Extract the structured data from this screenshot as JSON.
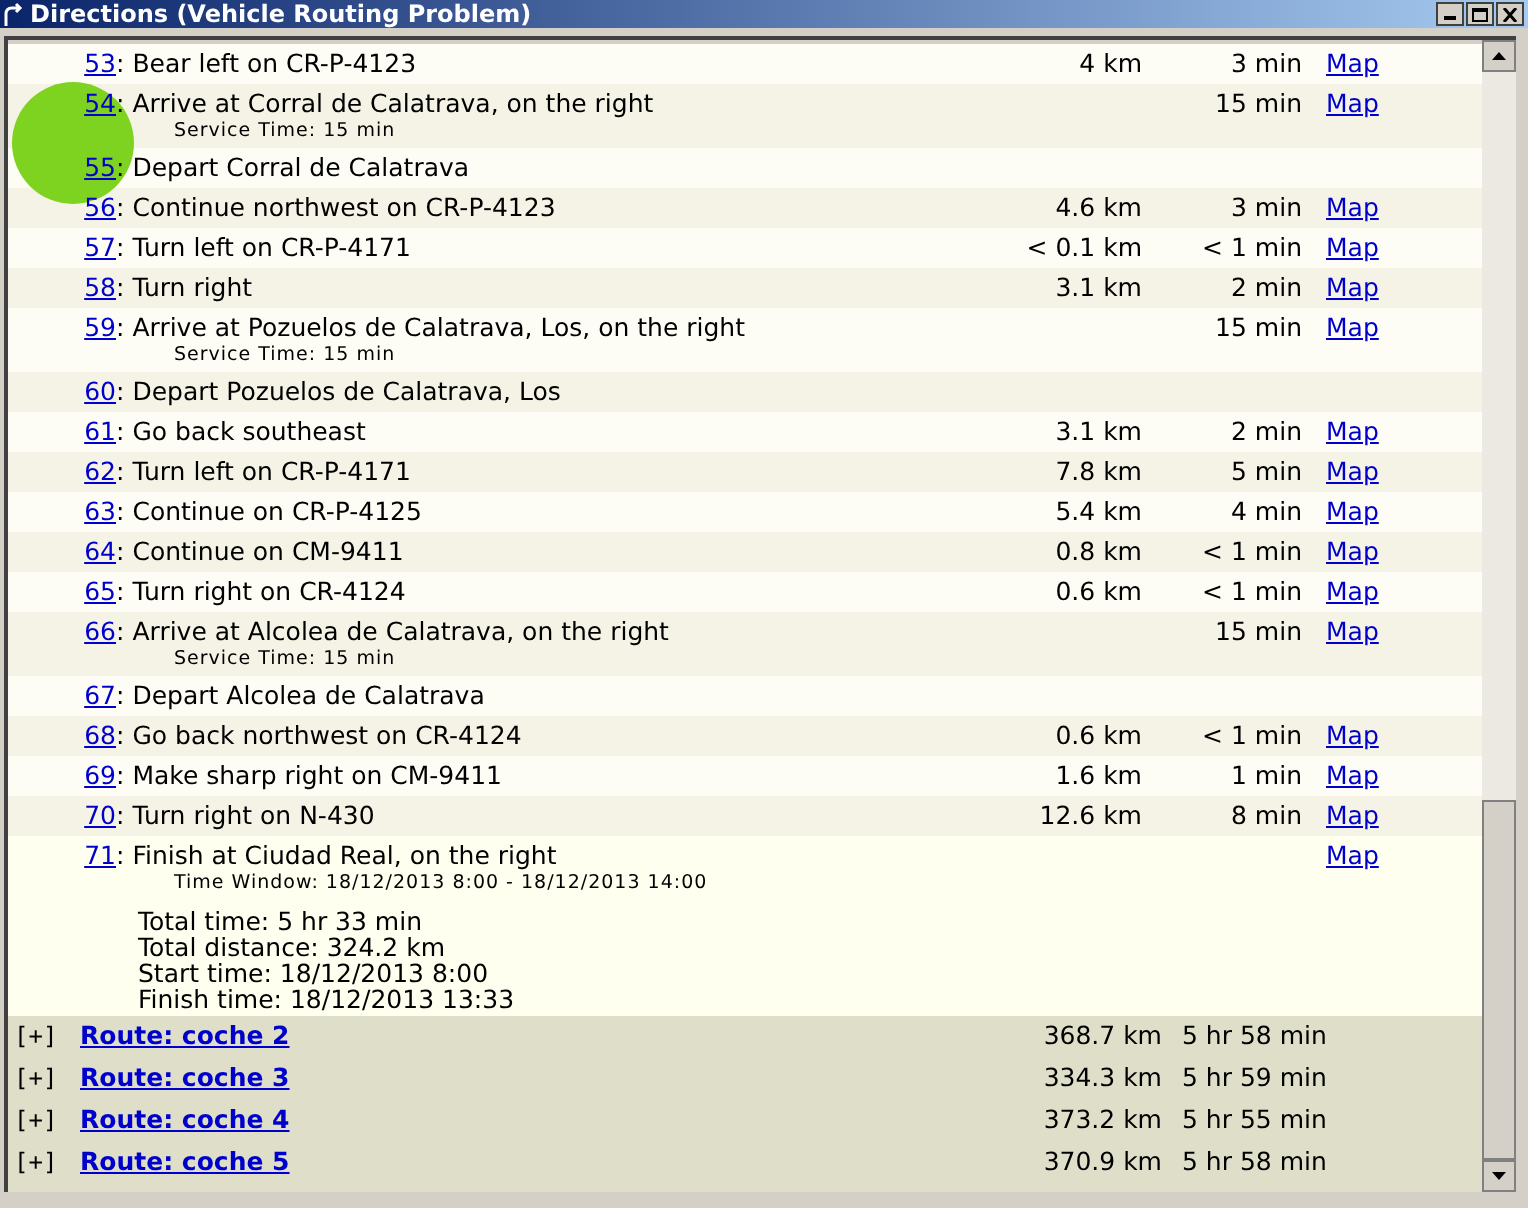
{
  "window": {
    "title": "Directions (Vehicle Routing Problem)"
  },
  "steps": [
    {
      "number": "53",
      "separator": ":",
      "text": "Bear left on CR-P-4123",
      "distance": "4 km",
      "time": "3 min",
      "map": "Map"
    },
    {
      "number": "54",
      "separator": ":",
      "text": "Arrive at Corral de Calatrava, on the right",
      "note": "Service Time: 15 min",
      "time": "15 min",
      "map": "Map"
    },
    {
      "number": "55",
      "separator": ":",
      "text": "Depart Corral de Calatrava"
    },
    {
      "number": "56",
      "separator": ":",
      "text": "Continue northwest on CR-P-4123",
      "distance": "4.6 km",
      "time": "3 min",
      "map": "Map"
    },
    {
      "number": "57",
      "separator": ":",
      "text": "Turn left on CR-P-4171",
      "distance": "< 0.1 km",
      "time": "< 1 min",
      "map": "Map"
    },
    {
      "number": "58",
      "separator": ":",
      "text": "Turn right",
      "distance": "3.1 km",
      "time": "2 min",
      "map": "Map"
    },
    {
      "number": "59",
      "separator": ":",
      "text": "Arrive at Pozuelos de Calatrava, Los, on the right",
      "note": "Service Time: 15 min",
      "time": "15 min",
      "map": "Map"
    },
    {
      "number": "60",
      "separator": ":",
      "text": "Depart Pozuelos de Calatrava, Los"
    },
    {
      "number": "61",
      "separator": ":",
      "text": "Go back southeast",
      "distance": "3.1 km",
      "time": "2 min",
      "map": "Map"
    },
    {
      "number": "62",
      "separator": ":",
      "text": "Turn left on CR-P-4171",
      "distance": "7.8 km",
      "time": "5 min",
      "map": "Map"
    },
    {
      "number": "63",
      "separator": ":",
      "text": "Continue on CR-P-4125",
      "distance": "5.4 km",
      "time": "4 min",
      "map": "Map"
    },
    {
      "number": "64",
      "separator": ":",
      "text": "Continue on CM-9411",
      "distance": "0.8 km",
      "time": "< 1 min",
      "map": "Map"
    },
    {
      "number": "65",
      "separator": ":",
      "text": "Turn right on CR-4124",
      "distance": "0.6 km",
      "time": "< 1 min",
      "map": "Map"
    },
    {
      "number": "66",
      "separator": ":",
      "text": "Arrive at Alcolea de Calatrava, on the right",
      "note": "Service Time: 15 min",
      "time": "15 min",
      "map": "Map"
    },
    {
      "number": "67",
      "separator": ":",
      "text": "Depart Alcolea de Calatrava"
    },
    {
      "number": "68",
      "separator": ":",
      "text": "Go back northwest on CR-4124",
      "distance": "0.6 km",
      "time": "< 1 min",
      "map": "Map"
    },
    {
      "number": "69",
      "separator": ":",
      "text": "Make sharp right on CM-9411",
      "distance": "1.6 km",
      "time": "1 min",
      "map": "Map"
    },
    {
      "number": "70",
      "separator": ":",
      "text": "Turn right on N-430",
      "distance": "12.6 km",
      "time": "8 min",
      "map": "Map"
    },
    {
      "number": "71",
      "separator": ":",
      "text": "Finish at Ciudad Real, on the right",
      "note": "Time Window: 18/12/2013 8:00 - 18/12/2013 14:00",
      "map": "Map"
    }
  ],
  "summary": [
    "Total time: 5 hr 33 min",
    "Total distance: 324.2 km",
    "Start time: 18/12/2013 8:00",
    "Finish time: 18/12/2013 13:33"
  ],
  "routes": [
    {
      "toggle": "[+]",
      "label": "Route: coche 2",
      "distance": "368.7 km",
      "time": "5 hr 58 min"
    },
    {
      "toggle": "[+]",
      "label": "Route: coche 3",
      "distance": "334.3 km",
      "time": "5 hr 59 min"
    },
    {
      "toggle": "[+]",
      "label": "Route: coche 4",
      "distance": "373.2 km",
      "time": "5 hr 55 min"
    },
    {
      "toggle": "[+]",
      "label": "Route: coche 5",
      "distance": "370.9 km",
      "time": "5 hr 58 min"
    }
  ]
}
